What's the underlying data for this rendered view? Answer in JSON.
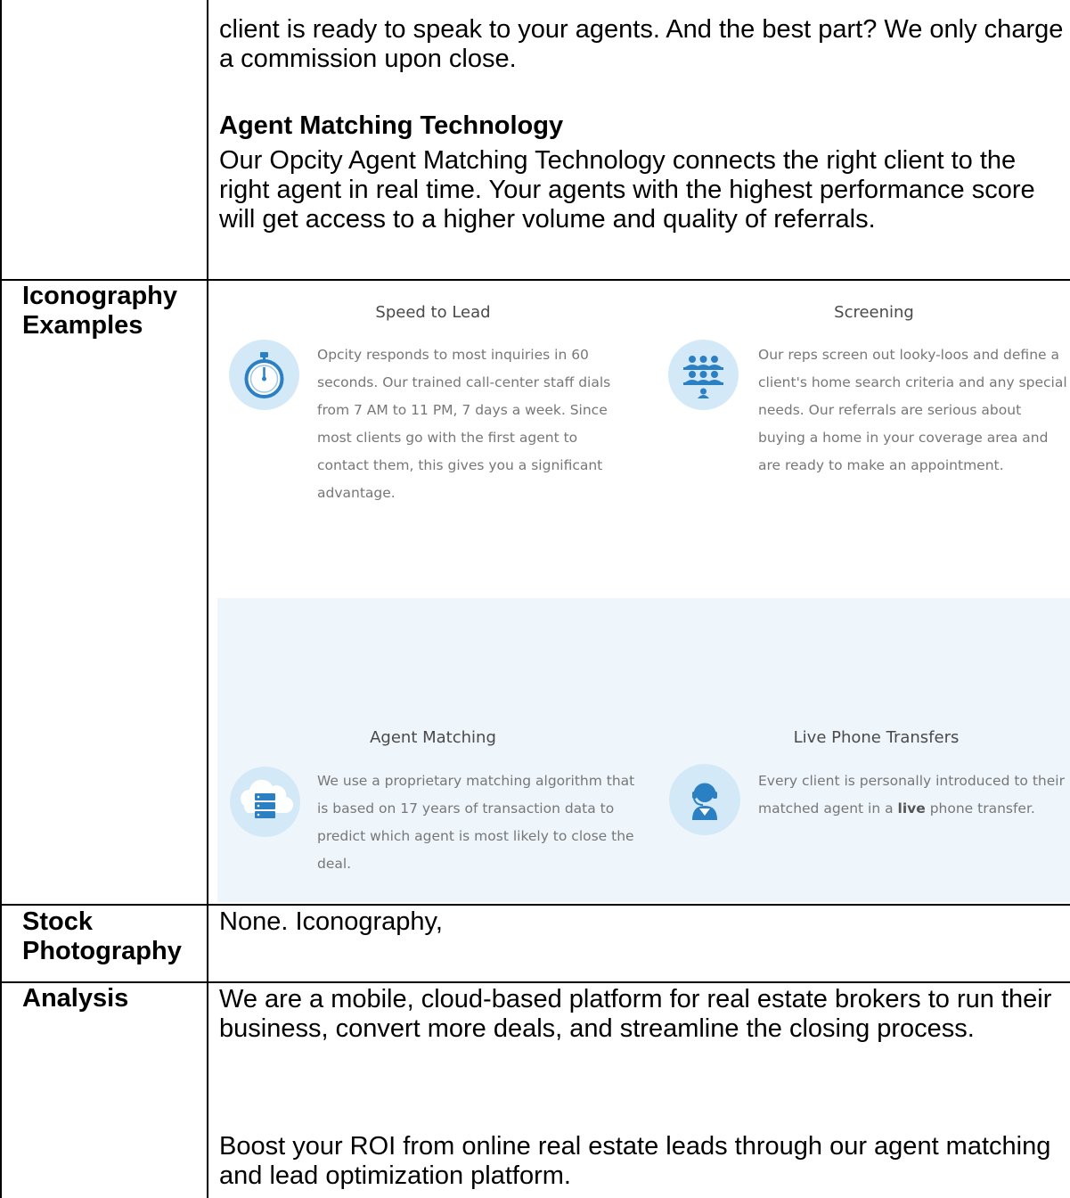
{
  "row_intro": {
    "continued_text": "client is ready to speak to your agents. And the best part? We only charge a commission upon close.",
    "heading": "Agent Matching Technology",
    "paragraph": "Our Opcity Agent Matching Technology connects the right client to the right agent in real time. Your agents with the highest performance score will get access to a higher volume and quality of referrals."
  },
  "row_iconography": {
    "label": "Iconography Examples",
    "features": [
      {
        "title": "Speed to Lead",
        "icon": "stopwatch-icon",
        "description": "Opcity responds to most inquiries in 60 seconds. Our trained call-center staff dials from 7 AM to 11 PM, 7 days a week. Since most clients go with the first agent to contact them, this gives you a significant advantage."
      },
      {
        "title": "Screening",
        "icon": "audience-icon",
        "description": "Our reps screen out looky-loos and define a client's home search criteria and any special needs. Our referrals are serious about buying a home in your coverage area and are ready to make an appointment."
      },
      {
        "title": "Agent Matching",
        "icon": "cloud-server-icon",
        "description": "We use a proprietary matching algorithm that is based on 17 years of transaction data to predict which agent is most likely to close the deal."
      },
      {
        "title": "Live Phone Transfers",
        "icon": "headset-agent-icon",
        "description_before": "Every client is personally introduced to their matched agent in a ",
        "description_bold": "live",
        "description_after": " phone transfer."
      }
    ]
  },
  "row_stock": {
    "label": "Stock Photography",
    "text": "None. Iconography,"
  },
  "row_analysis": {
    "label": "Analysis",
    "paragraph1": "We are a mobile, cloud-based platform for real estate brokers to run their business, convert more deals, and streamline the closing process.",
    "paragraph2": "Boost your ROI from online real estate leads through our agent matching and lead optimization platform."
  },
  "colors": {
    "icon_circle": "#d4e9f7",
    "icon_blue": "#2b7fc3",
    "panel_bg": "#eef6fc",
    "border": "#000000"
  }
}
